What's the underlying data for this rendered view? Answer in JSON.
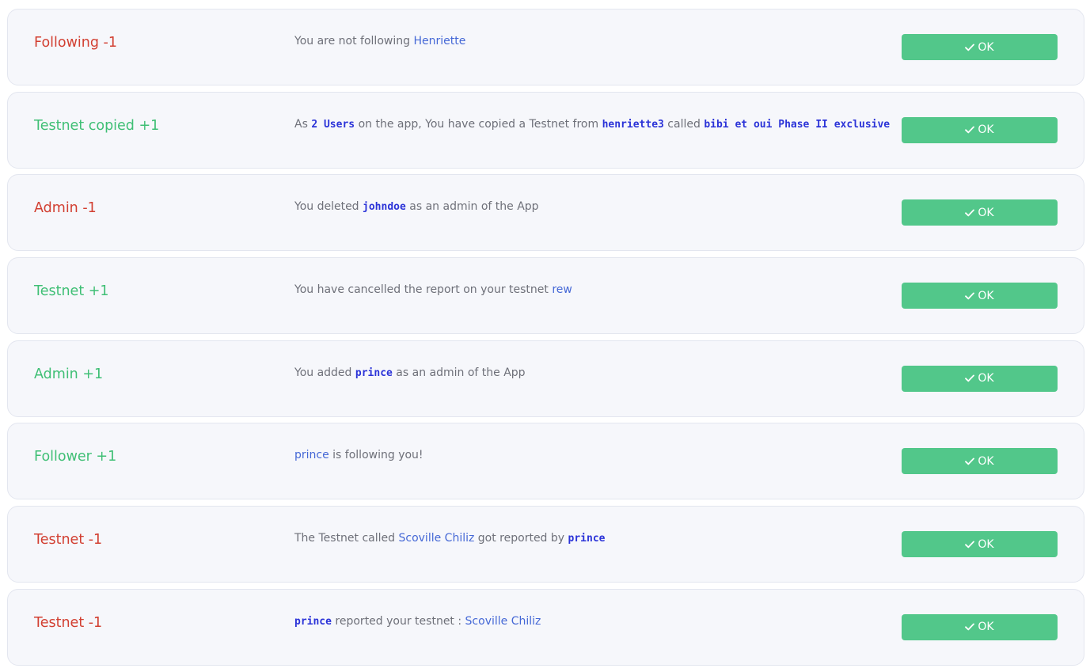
{
  "colors": {
    "positive": "#3fbf75",
    "negative": "#d23f31",
    "card_background": "#f6f7fb",
    "button": "#52c78a",
    "link": "#4568d6",
    "code": "#2b33d8",
    "message_text": "#6e7079"
  },
  "notifications": [
    {
      "title": "Following -1",
      "tone": "negative",
      "message": [
        {
          "type": "text",
          "text": "You are not following "
        },
        {
          "type": "link",
          "text": "Henriette"
        }
      ],
      "button": {
        "icon": "check-icon",
        "label": "OK"
      }
    },
    {
      "title": "Testnet copied +1",
      "tone": "positive",
      "message": [
        {
          "type": "text",
          "text": "As "
        },
        {
          "type": "code",
          "text": "2 Users"
        },
        {
          "type": "text",
          "text": " on the app, You have copied a Testnet from "
        },
        {
          "type": "code",
          "text": "henriette3"
        },
        {
          "type": "text",
          "text": "  called "
        },
        {
          "type": "code",
          "text": "bibi et oui Phase II exclusive"
        }
      ],
      "button": {
        "icon": "check-icon",
        "label": "OK"
      }
    },
    {
      "title": "Admin -1",
      "tone": "negative",
      "message": [
        {
          "type": "text",
          "text": "You deleted "
        },
        {
          "type": "code",
          "text": "johndoe"
        },
        {
          "type": "text",
          "text": "  as an admin of the App"
        }
      ],
      "button": {
        "icon": "check-icon",
        "label": "OK"
      }
    },
    {
      "title": "Testnet +1",
      "tone": "positive",
      "message": [
        {
          "type": "text",
          "text": "You have cancelled the report on your testnet "
        },
        {
          "type": "link",
          "text": "rew"
        }
      ],
      "button": {
        "icon": "check-icon",
        "label": "OK"
      }
    },
    {
      "title": "Admin +1",
      "tone": "positive",
      "message": [
        {
          "type": "text",
          "text": "You added "
        },
        {
          "type": "code",
          "text": "prince"
        },
        {
          "type": "text",
          "text": " as an admin of the App"
        }
      ],
      "button": {
        "icon": "check-icon",
        "label": "OK"
      }
    },
    {
      "title": "Follower +1",
      "tone": "positive",
      "message": [
        {
          "type": "link",
          "text": "prince"
        },
        {
          "type": "text",
          "text": " is following you!"
        }
      ],
      "button": {
        "icon": "check-icon",
        "label": "OK"
      }
    },
    {
      "title": "Testnet -1",
      "tone": "negative",
      "message": [
        {
          "type": "text",
          "text": "The Testnet called "
        },
        {
          "type": "link",
          "text": "Scoville Chiliz"
        },
        {
          "type": "text",
          "text": " got reported by "
        },
        {
          "type": "code",
          "text": "prince"
        }
      ],
      "button": {
        "icon": "check-icon",
        "label": "OK"
      }
    },
    {
      "title": "Testnet -1",
      "tone": "negative",
      "message": [
        {
          "type": "code",
          "text": "prince"
        },
        {
          "type": "text",
          "text": " reported your testnet : "
        },
        {
          "type": "link",
          "text": "Scoville Chiliz"
        }
      ],
      "button": {
        "icon": "check-icon",
        "label": "OK"
      }
    }
  ]
}
